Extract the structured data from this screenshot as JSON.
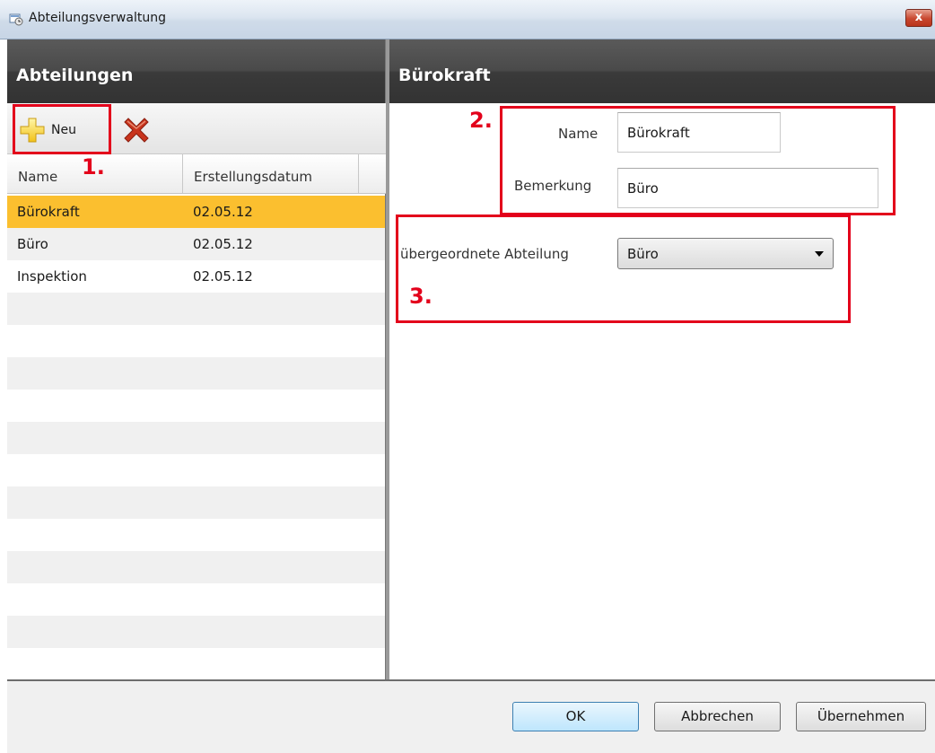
{
  "window": {
    "title": "Abteilungsverwaltung",
    "close_label": "x"
  },
  "left_panel": {
    "header": "Abteilungen",
    "toolbar": {
      "new_label": "Neu"
    },
    "columns": [
      "Name",
      "Erstellungsdatum"
    ],
    "rows": [
      {
        "name": "Bürokraft",
        "date": "02.05.12",
        "selected": true
      },
      {
        "name": "Büro",
        "date": "02.05.12",
        "selected": false
      },
      {
        "name": "Inspektion",
        "date": "02.05.12",
        "selected": false
      }
    ]
  },
  "right_panel": {
    "header": "Bürokraft",
    "name_label": "Name",
    "name_value": "Bürokraft",
    "remark_label": "Bemerkung",
    "remark_value": "Büro",
    "parent_label": "übergeordnete Abteilung",
    "parent_value": "Büro"
  },
  "buttons": {
    "ok": "OK",
    "cancel": "Abbrechen",
    "apply": "Übernehmen"
  },
  "annotations": {
    "n1": "1.",
    "n2": "2.",
    "n3": "3."
  },
  "colors": {
    "selection": "#fbbf2f",
    "annotation": "#e3001b",
    "header_dark": "#444444"
  }
}
